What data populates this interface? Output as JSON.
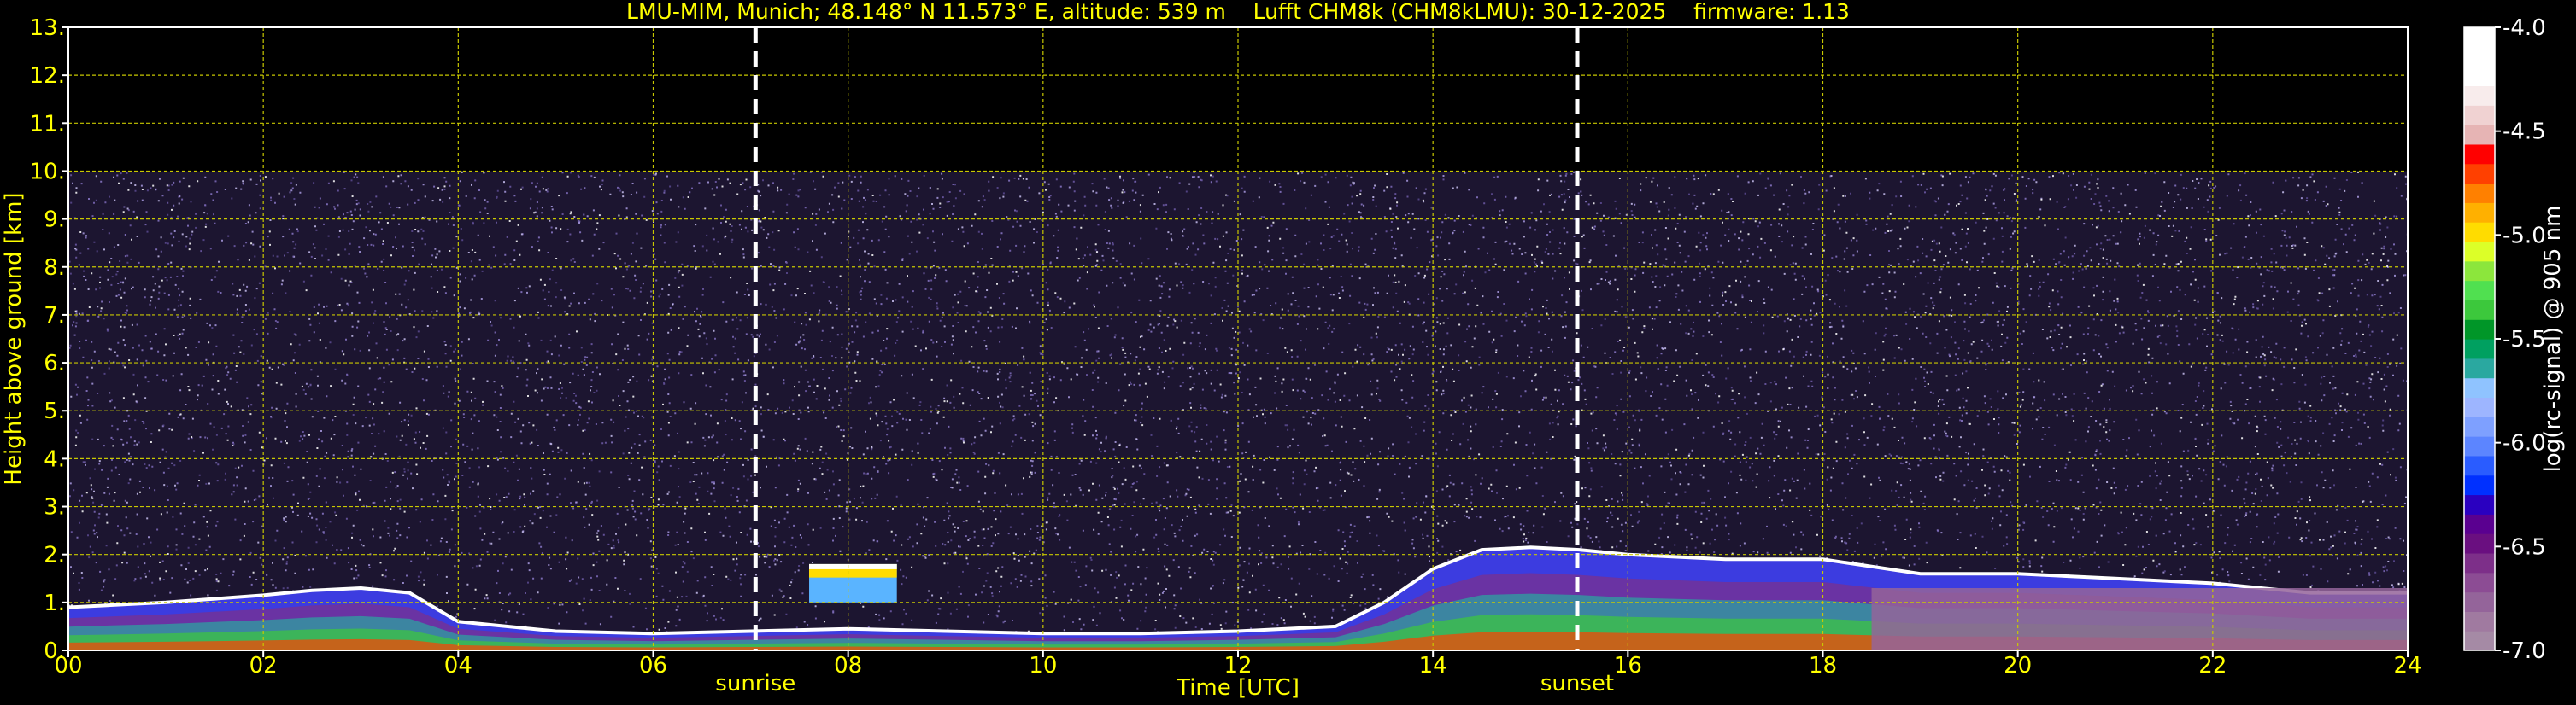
{
  "title": "LMU-MIM, Munich; 48.148° N 11.573° E, altitude: 539 m    Lufft CHM8k (CHM8kLMU): 30-12-2025    firmware: 1.13",
  "colors": {
    "background": "#000000",
    "axis_text": "#ffff00",
    "grid": "#c8c800",
    "marker_line": "#ffffff",
    "colorbar_label": "#ffffff"
  },
  "chart_data": {
    "type": "heatmap",
    "title": "LMU-MIM, Munich; 48.148° N 11.573° E, altitude: 539 m    Lufft CHM8k (CHM8kLMU): 30-12-2025    firmware: 1.13",
    "xlabel": "Time [UTC]",
    "ylabel": "Height above ground [km]",
    "xlim": [
      0,
      24
    ],
    "ylim": [
      0,
      13
    ],
    "x_ticks": [
      "00",
      "02",
      "04",
      "06",
      "08",
      "10",
      "12",
      "14",
      "16",
      "18",
      "20",
      "22",
      "24"
    ],
    "x_tick_values": [
      0,
      2,
      4,
      6,
      8,
      10,
      12,
      14,
      16,
      18,
      20,
      22,
      24
    ],
    "y_ticks": [
      "0.",
      "1.",
      "2.",
      "3.",
      "4.",
      "5.",
      "6.",
      "7.",
      "8.",
      "9.",
      "10.",
      "11.",
      "12.",
      "13."
    ],
    "y_tick_values": [
      0,
      1,
      2,
      3,
      4,
      5,
      6,
      7,
      8,
      9,
      10,
      11,
      12,
      13
    ],
    "grid": true,
    "data_top_km": 10,
    "markers": [
      {
        "label": "sunrise",
        "x": 7.05
      },
      {
        "label": "sunset",
        "x": 15.48
      }
    ],
    "colorbar": {
      "label": "log(rc-signal) @ 905 nm",
      "range": [
        -7.0,
        -4.0
      ],
      "ticks": [
        "-4.0",
        "-4.5",
        "-5.0",
        "-5.5",
        "-6.0",
        "-6.5",
        "-7.0"
      ],
      "tick_values": [
        -4.0,
        -4.5,
        -5.0,
        -5.5,
        -6.0,
        -6.5,
        -7.0
      ],
      "colors": [
        "#a58aa5",
        "#a07aa0",
        "#94649a",
        "#8c4c94",
        "#7d2f89",
        "#6a0f80",
        "#5a0090",
        "#2a00c0",
        "#0030ff",
        "#2a5cff",
        "#5c85ff",
        "#7ea0ff",
        "#9db5ff",
        "#8fc3ff",
        "#2aa8a0",
        "#00a060",
        "#009628",
        "#3cc83c",
        "#50e050",
        "#8ce63c",
        "#dcff28",
        "#ffdc00",
        "#ffb000",
        "#ff8000",
        "#ff4000",
        "#ff0000",
        "#e6b4b4",
        "#f0d2d2",
        "#f8ecec",
        "#ffffff",
        "#ffffff",
        "#ffffff"
      ]
    },
    "cloud_layers": [
      {
        "name": "boundary layer",
        "x": [
          0.0,
          1.0,
          2.0,
          2.5,
          3.0,
          3.5,
          4.0,
          5.0,
          6.0,
          7.0,
          8.0,
          9.0,
          10.0,
          11.0,
          12.0,
          13.0,
          13.5,
          14.0,
          14.5,
          15.0,
          15.5,
          16.0,
          17.0,
          18.0,
          19.0,
          20.0,
          21.0,
          22.0,
          23.0,
          24.0
        ],
        "top_km": [
          0.9,
          1.0,
          1.15,
          1.25,
          1.3,
          1.2,
          0.6,
          0.4,
          0.35,
          0.4,
          0.45,
          0.4,
          0.35,
          0.35,
          0.4,
          0.5,
          1.0,
          1.7,
          2.1,
          2.15,
          2.1,
          2.0,
          1.9,
          1.9,
          1.6,
          1.6,
          1.5,
          1.4,
          1.2,
          1.2
        ]
      },
      {
        "name": "elevated layer 08h",
        "x": [
          7.6,
          8.5
        ],
        "bottom_km": 1.0,
        "top_km": 1.8
      }
    ]
  }
}
